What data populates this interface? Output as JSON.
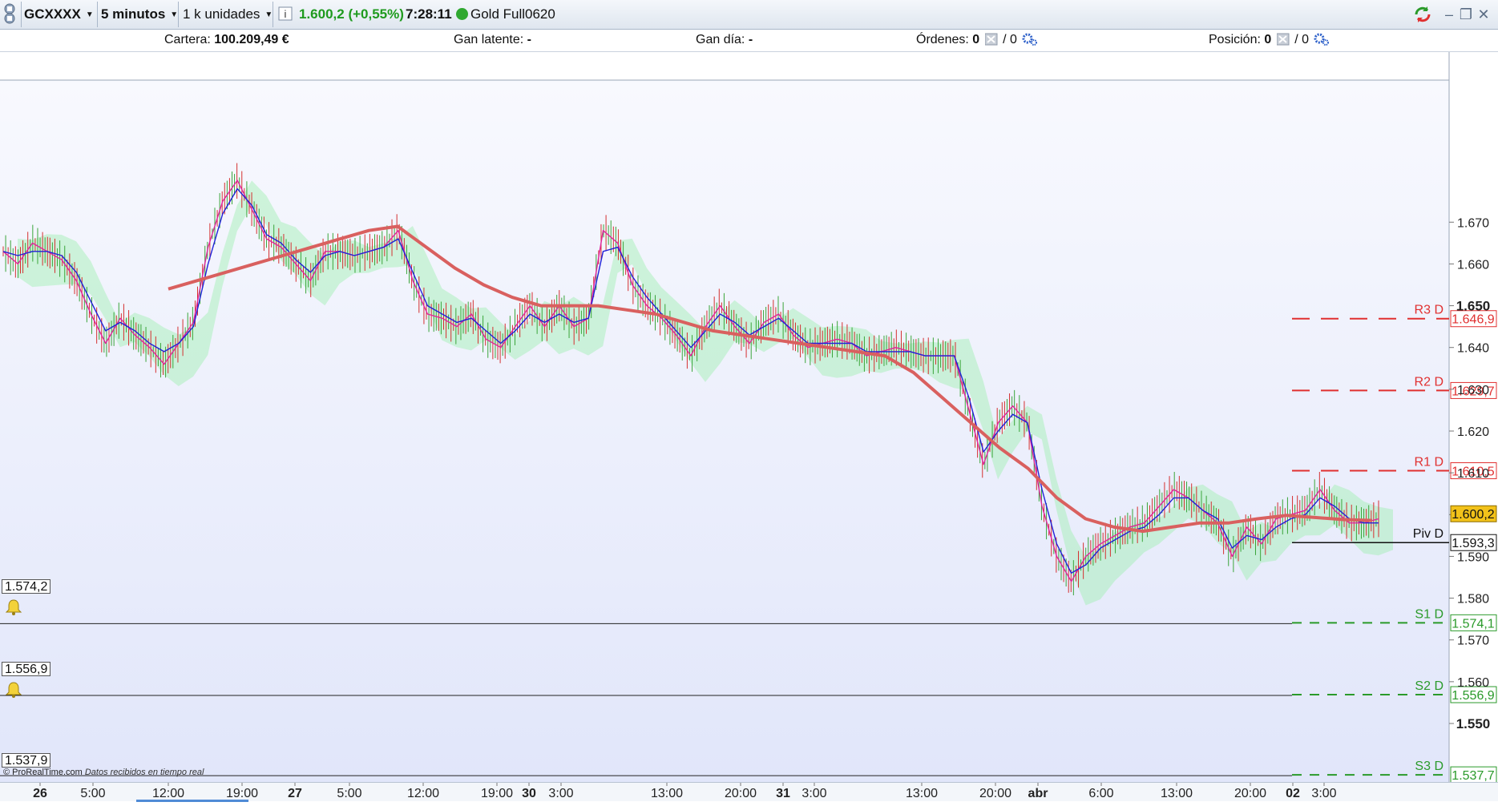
{
  "toolbar": {
    "instrument": "GCXXXX",
    "timeframe": "5 minutos",
    "units": "1 k unidades",
    "info_icon": "info-icon",
    "price": "1.600,2 (+0,55%)",
    "time": "7:28:11",
    "contract": "Gold Full0620",
    "price_color": "#1e9a1e",
    "status_color": "#2fa830"
  },
  "infobar": {
    "portfolio_label": "Cartera:",
    "portfolio_value": "100.209,49 €",
    "unrealized_label": "Gan latente:",
    "unrealized_value": "-",
    "daily_label": "Gan día:",
    "daily_value": "-",
    "orders_label": "Órdenes:",
    "orders_value": "0",
    "orders_sep": "/ 0",
    "position_label": "Posición:",
    "position_value": "0",
    "position_sep": "/ 0"
  },
  "alerts": [
    {
      "value": "1.574,2"
    },
    {
      "value": "1.556,9"
    },
    {
      "value": "1.537,9"
    }
  ],
  "footnote": {
    "brand": "© ProRealTime.com",
    "status": "Datos recibidos en tiempo real"
  },
  "chart_data": {
    "type": "line",
    "x_ticks": [
      "26",
      "5:00",
      "12:00",
      "19:00",
      "27",
      "5:00",
      "12:00",
      "19:00",
      "30",
      "3:00",
      "13:00",
      "20:00",
      "31",
      "3:00",
      "13:00",
      "20:00",
      "abr",
      "6:00",
      "13:00",
      "20:00",
      "02",
      "3:00"
    ],
    "bold_x_ticks": [
      "26",
      "27",
      "30",
      "31",
      "abr",
      "02"
    ],
    "y_ticks": [
      "1.670",
      "1.660",
      "1.650",
      "1.640",
      "1.630",
      "1.620",
      "1.610",
      "1.600",
      "1.590",
      "1.580",
      "1.570",
      "1.560",
      "1.550"
    ],
    "bold_y_ticks": [
      "1.650",
      "1.550"
    ],
    "ylim": [
      1536,
      1704
    ],
    "current_price": "1.600,2",
    "current_price_value": 1600.2,
    "pivots": [
      {
        "label": "R3 D",
        "value": 1646.9,
        "text": "1.646,9",
        "color": "#e03030"
      },
      {
        "label": "R2 D",
        "value": 1629.7,
        "text": "1.629,7",
        "color": "#e03030"
      },
      {
        "label": "R1 D",
        "value": 1610.5,
        "text": "1.610,5",
        "color": "#e03030"
      },
      {
        "label": "Piv D",
        "value": 1593.3,
        "text": "1.593,3",
        "color": "#111111"
      },
      {
        "label": "S1 D",
        "value": 1574.1,
        "text": "1.574,1",
        "color": "#2a9a2a"
      },
      {
        "label": "S2 D",
        "value": 1556.9,
        "text": "1.556,9",
        "color": "#2a9a2a"
      },
      {
        "label": "S3 D",
        "value": 1537.7,
        "text": "1.537,7",
        "color": "#2a9a2a"
      }
    ],
    "series": [
      {
        "role": "price",
        "color": "#e0239b",
        "values": [
          1663,
          1660,
          1665,
          1663,
          1661,
          1656,
          1648,
          1641,
          1647,
          1643,
          1640,
          1636,
          1641,
          1646,
          1664,
          1675,
          1680,
          1673,
          1666,
          1664,
          1660,
          1656,
          1663,
          1663,
          1662,
          1663,
          1664,
          1668,
          1656,
          1648,
          1647,
          1645,
          1648,
          1642,
          1640,
          1645,
          1650,
          1645,
          1650,
          1645,
          1647,
          1668,
          1665,
          1655,
          1650,
          1647,
          1643,
          1638,
          1645,
          1650,
          1645,
          1641,
          1646,
          1648,
          1643,
          1640,
          1641,
          1642,
          1641,
          1638,
          1639,
          1640,
          1639,
          1638,
          1638,
          1638,
          1625,
          1612,
          1622,
          1626,
          1622,
          1602,
          1590,
          1584,
          1590,
          1593,
          1595,
          1597,
          1598,
          1602,
          1606,
          1604,
          1601,
          1598,
          1590,
          1597,
          1593,
          1599,
          1600,
          1601,
          1606,
          1601,
          1598,
          1598,
          1599
        ]
      },
      {
        "role": "average",
        "color": "#2121d8",
        "values": [
          1663,
          1662,
          1663,
          1663,
          1662,
          1658,
          1651,
          1644,
          1646,
          1644,
          1641,
          1639,
          1641,
          1645,
          1660,
          1672,
          1678,
          1674,
          1667,
          1665,
          1661,
          1658,
          1662,
          1663,
          1662,
          1663,
          1664,
          1666,
          1658,
          1650,
          1648,
          1646,
          1647,
          1644,
          1641,
          1644,
          1648,
          1646,
          1648,
          1646,
          1647,
          1663,
          1664,
          1657,
          1652,
          1648,
          1644,
          1640,
          1644,
          1648,
          1646,
          1643,
          1645,
          1647,
          1644,
          1641,
          1641,
          1641,
          1641,
          1639,
          1639,
          1639,
          1639,
          1638,
          1638,
          1638,
          1628,
          1615,
          1620,
          1624,
          1622,
          1606,
          1593,
          1586,
          1588,
          1592,
          1594,
          1596,
          1597,
          1600,
          1604,
          1604,
          1601,
          1599,
          1592,
          1595,
          1594,
          1597,
          1599,
          1600,
          1604,
          1602,
          1599,
          1598,
          1598
        ]
      },
      {
        "role": "moving-average",
        "color": "#d9605f",
        "values": [
          1654,
          1656,
          1658,
          1660,
          1662,
          1664,
          1666,
          1668,
          1669,
          1664,
          1659,
          1655,
          1652,
          1650,
          1650,
          1650,
          1649,
          1648,
          1646,
          1644,
          1643,
          1642,
          1641,
          1640,
          1639,
          1638,
          1634,
          1628,
          1622,
          1616,
          1611,
          1604,
          1599,
          1597,
          1596,
          1597,
          1598,
          1598,
          1599,
          1599.8,
          1599.3,
          1598.8,
          1598.6
        ]
      }
    ],
    "cloud_color": "#9eefb0"
  }
}
